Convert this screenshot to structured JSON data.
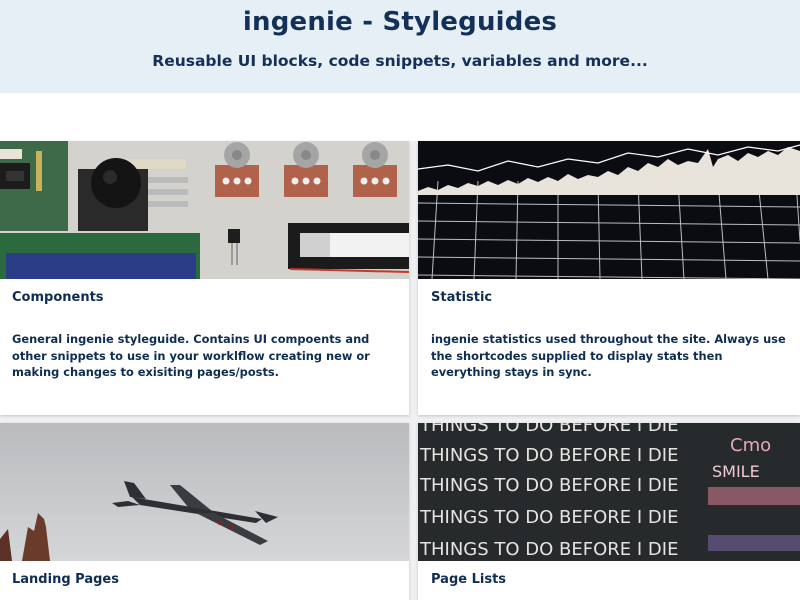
{
  "header": {
    "title": "ingenie - Styleguides",
    "subtitle": "Reusable UI blocks, code snippets, variables and more..."
  },
  "cards": [
    {
      "title": "Components",
      "description": "General ingenie styleguide. Contains UI compoents and other snippets to use in your worklflow creating new or making changes to exisiting pages/posts.",
      "image": "electronics-components-photo"
    },
    {
      "title": "Statistic",
      "description": "ingenie statistics used throughout the site. Always use the shortcodes supplied to display stats then everything stays in sync.",
      "image": "stock-chart-grid-photo"
    },
    {
      "title": "Landing Pages",
      "description": "",
      "image": "airplane-sky-photo"
    },
    {
      "title": "Page Lists",
      "description": "",
      "image": "chalkboard-writing-photo",
      "chalk_text": [
        "THINGS TO DO BEFORE I DIE",
        "Cmo",
        "SMILE"
      ]
    }
  ],
  "colors": {
    "header_bg": "#e6eef6",
    "text": "#0f2d52",
    "card_bg": "#ffffff",
    "page_bg": "#f0f0f2"
  }
}
